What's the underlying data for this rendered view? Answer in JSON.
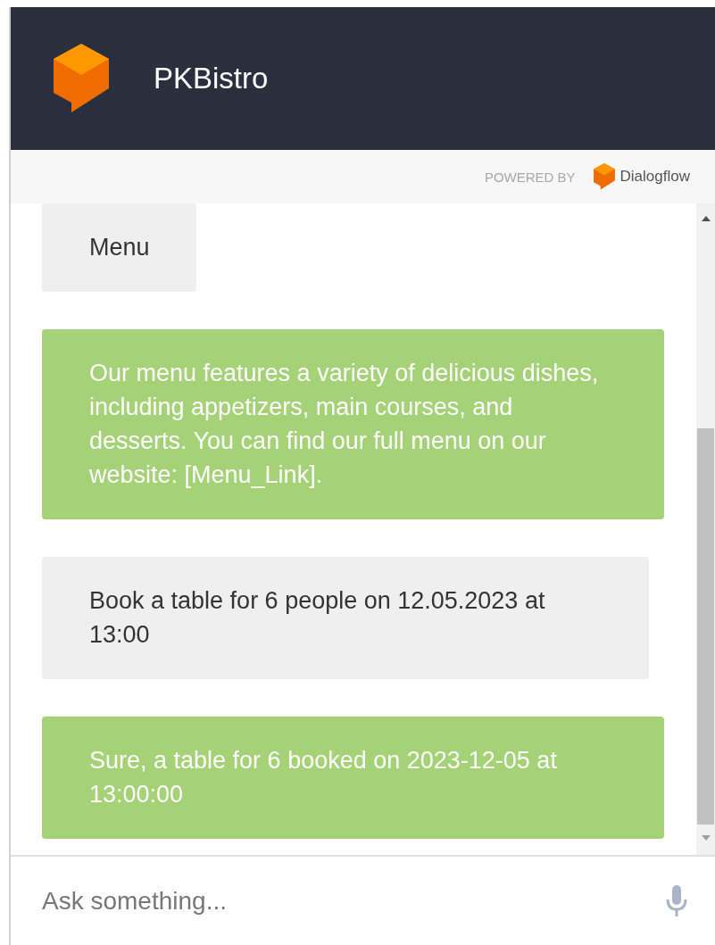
{
  "header": {
    "title": "PKBistro"
  },
  "powered_by": {
    "label": "POWERED BY",
    "brand": "Dialogflow"
  },
  "messages": [
    {
      "kind": "user",
      "text": "Menu"
    },
    {
      "kind": "bot",
      "text": "Our menu features a variety of delicious dishes, including appetizers, main courses, and desserts. You can find our full menu on our website: [Menu_Link]."
    },
    {
      "kind": "user",
      "text": "Book a table for 6 people on 12.05.2023 at 13:00"
    },
    {
      "kind": "bot",
      "text": "Sure, a table for 6 booked on 2023-12-05 at 13:00:00"
    }
  ],
  "input": {
    "placeholder": "Ask something..."
  }
}
